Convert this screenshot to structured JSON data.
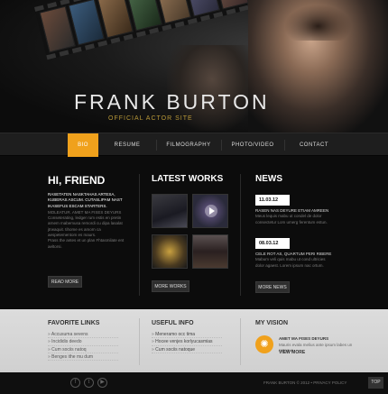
{
  "header": {
    "title": "FRANK BURTON",
    "subtitle": "OFFICIAL ACTOR SITE"
  },
  "nav": {
    "items": [
      {
        "label": "BIO",
        "active": true
      },
      {
        "label": "RESUME",
        "active": false
      },
      {
        "label": "FILMOGRAPHY",
        "active": false
      },
      {
        "label": "PHOTO/VIDEO",
        "active": false
      },
      {
        "label": "CONTACT",
        "active": false
      }
    ]
  },
  "hello": {
    "title": "HI, FRIEND",
    "lead": "RASETATEN NASKTAHAS ARTESA, KUBERAS ASCUM. CUTASLIPAM NAST IKASEFUS ESCAM STARTERS.",
    "sub": "MOLEATUR. AMET MA FISES DEYURS",
    "muted1": "Conseterating, ledger rum estis en pretin arnem mabemusa remordi cu dipa lasalat jtrwaquit. tihome es amorn ca aespetementom es maurs.",
    "muted2": "Prass the antes et un plan Fhtasmilate ent aeltorsi.",
    "button": "READ MORE"
  },
  "works": {
    "title": "LATEST WORKS",
    "button": "MORE WORKS"
  },
  "news": {
    "title": "NEWS",
    "items": [
      {
        "date": "11.03.12",
        "lead": "RASEN NAS DEYURE ETIAM AMREEN",
        "muted": "Meus lequis mabu ut condel de dolor consectetur Lom umerg ferentum estun."
      },
      {
        "date": "08.03.12",
        "lead": "CELE ROT AS, QUARTUM PERI RIBERE",
        "muted": "Mabum veli quis mabu ut cond ultricies dolor agaest. Lorem ipsum nac ortum."
      }
    ],
    "button": "MORE NEWS"
  },
  "footer": {
    "favorite_title": "FAVORITE LINKS",
    "favorite_links": [
      "Accusuma sevens",
      "Incididis deedo",
      "Cum sociis natoq",
      "Benges ithe mu dum"
    ],
    "useful_title": "USEFUL INFO",
    "useful_links": [
      "Meneramo occ tima",
      "Hocee venjes korlyucasmias",
      "Cum sociis natoque"
    ],
    "vision_title": "MY VISION",
    "vision_heading": "AMET MA FISES DEYURS",
    "vision_text": "Mauris evala melius ante ipsum labes un natoque.",
    "vision_link": "VIEW MORE"
  },
  "bottom": {
    "copyright": "FRANK BURTON © 2012 • PRIVACY POLICY",
    "top_label": "TOP"
  },
  "colors": {
    "accent": "#f0a11c",
    "background": "#0c0c0c",
    "footer": "#d6d6d6"
  },
  "icons": [
    "facebook-icon",
    "twitter-icon",
    "youtube-icon",
    "play-icon",
    "star-icon"
  ]
}
